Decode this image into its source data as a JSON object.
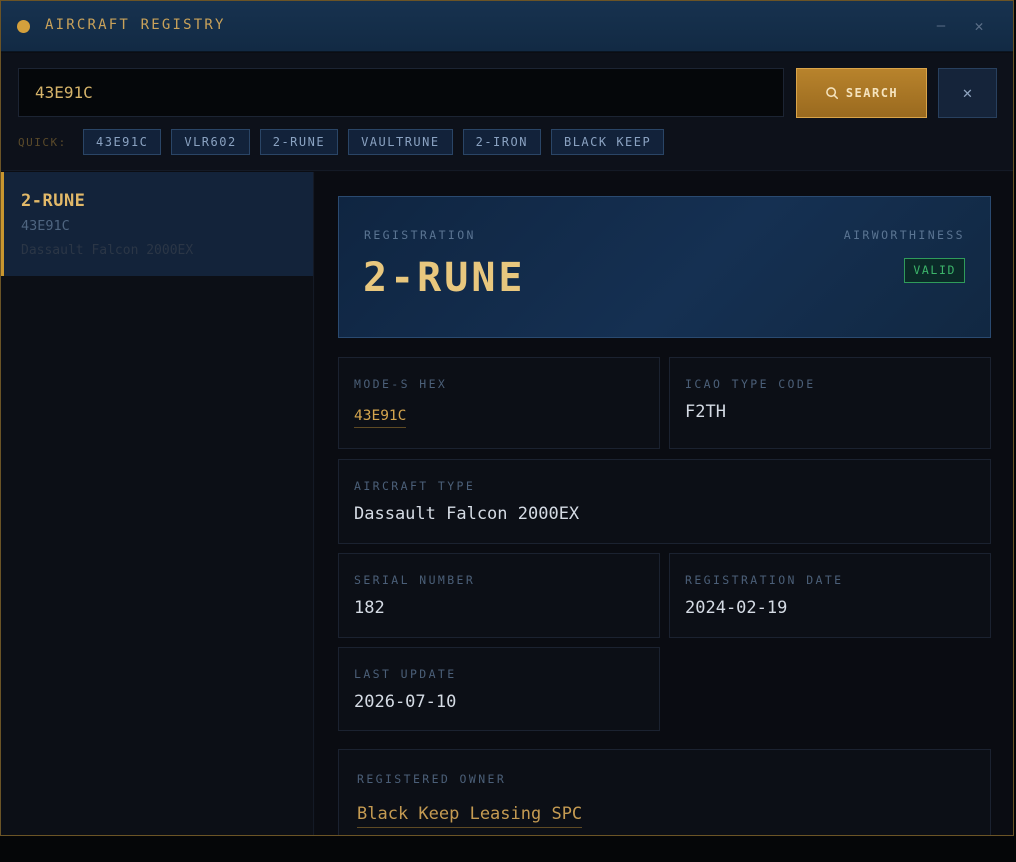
{
  "window": {
    "title": "AIRCRAFT REGISTRY",
    "minimize": "–",
    "close": "✕"
  },
  "search": {
    "value": "43E91C",
    "button_label": "SEARCH",
    "clear_label": "✕",
    "quick_label": "QUICK:",
    "quick_items": [
      "43E91C",
      "VLR602",
      "2-RUNE",
      "VAULTRUNE",
      "2-IRON",
      "BLACK KEEP"
    ]
  },
  "results": [
    {
      "registration": "2-RUNE",
      "hex": "43E91C",
      "type": "Dassault Falcon 2000EX"
    }
  ],
  "detail": {
    "registration_label": "REGISTRATION",
    "registration": "2-RUNE",
    "airworthiness_label": "AIRWORTHINESS",
    "airworthiness": "VALID",
    "mode_s_label": "MODE-S HEX",
    "mode_s": "43E91C",
    "icao_label": "ICAO TYPE CODE",
    "icao": "F2TH",
    "aircraft_type_label": "AIRCRAFT TYPE",
    "aircraft_type": "Dassault Falcon 2000EX",
    "serial_label": "SERIAL NUMBER",
    "serial": "182",
    "reg_date_label": "REGISTRATION DATE",
    "reg_date": "2024-02-19",
    "last_update_label": "LAST UPDATE",
    "last_update": "2026-07-10",
    "owner_label": "REGISTERED OWNER",
    "owner": "Black Keep Leasing SPC"
  },
  "colors": {
    "accent": "#d4a03c",
    "valid": "#3cb56a",
    "panel": "#13233a"
  }
}
